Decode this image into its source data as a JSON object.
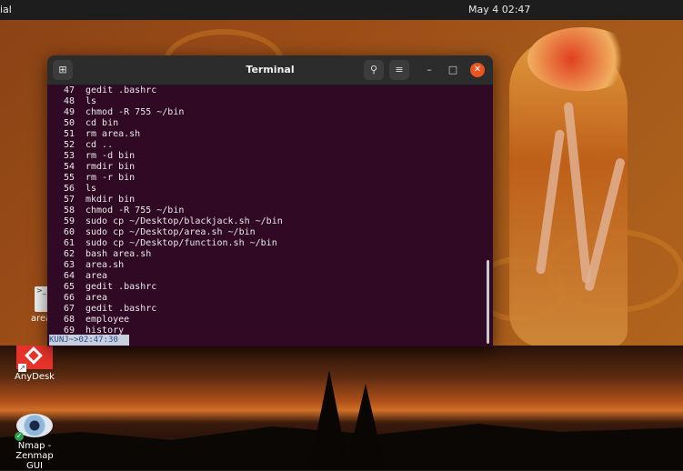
{
  "topbar": {
    "activities_label": "ial",
    "datetime": "May 4  02:47"
  },
  "terminal": {
    "title": "Terminal",
    "history": [
      {
        "n": "47",
        "cmd": "gedit .bashrc"
      },
      {
        "n": "48",
        "cmd": "ls"
      },
      {
        "n": "49",
        "cmd": "chmod -R 755 ~/bin"
      },
      {
        "n": "50",
        "cmd": "cd bin"
      },
      {
        "n": "51",
        "cmd": "rm area.sh"
      },
      {
        "n": "52",
        "cmd": "cd .."
      },
      {
        "n": "53",
        "cmd": "rm -d bin"
      },
      {
        "n": "54",
        "cmd": "rmdir bin"
      },
      {
        "n": "55",
        "cmd": "rm -r bin"
      },
      {
        "n": "56",
        "cmd": "ls"
      },
      {
        "n": "57",
        "cmd": "mkdir bin"
      },
      {
        "n": "58",
        "cmd": "chmod -R 755 ~/bin"
      },
      {
        "n": "59",
        "cmd": "sudo cp ~/Desktop/blackjack.sh ~/bin"
      },
      {
        "n": "60",
        "cmd": "sudo cp ~/Desktop/area.sh ~/bin"
      },
      {
        "n": "61",
        "cmd": "sudo cp ~/Desktop/function.sh ~/bin"
      },
      {
        "n": "62",
        "cmd": "bash area.sh"
      },
      {
        "n": "63",
        "cmd": "area.sh"
      },
      {
        "n": "64",
        "cmd": "area"
      },
      {
        "n": "65",
        "cmd": "gedit .bashrc"
      },
      {
        "n": "66",
        "cmd": "area"
      },
      {
        "n": "67",
        "cmd": "gedit .bashrc"
      },
      {
        "n": "68",
        "cmd": "employee"
      },
      {
        "n": "69",
        "cmd": "history"
      }
    ],
    "prompt": "KUNJ~>02:47:30"
  },
  "desktop": {
    "icons": [
      {
        "label": "area",
        "icon": "script-file-icon"
      },
      {
        "label": "AnyDesk",
        "icon": "anydesk-icon"
      },
      {
        "label": "Nmap -\nZenmap GUI",
        "icon": "zenmap-eye-icon"
      }
    ],
    "area_label": "area",
    "anydesk_label": "AnyDesk",
    "zenmap_line1": "Nmap -",
    "zenmap_line2": "Zenmap GUI"
  },
  "colors": {
    "terminal_bg": "#300a24",
    "close_button": "#e95420",
    "prompt_bg": "#c8d0e0"
  }
}
